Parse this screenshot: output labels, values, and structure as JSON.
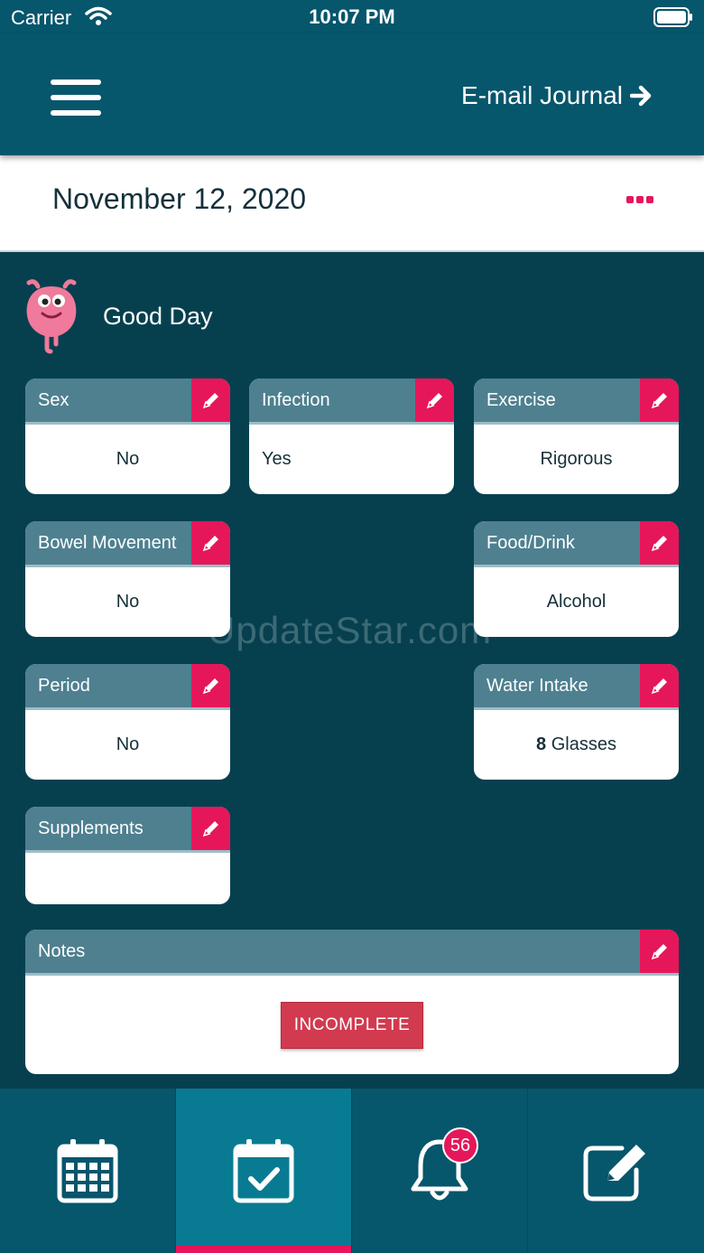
{
  "status_bar": {
    "carrier": "Carrier",
    "time": "10:07 PM"
  },
  "header": {
    "email_label": "E-mail Journal"
  },
  "date_bar": {
    "date": "November 12, 2020"
  },
  "mood": {
    "label": "Good Day"
  },
  "cards": {
    "sex": {
      "title": "Sex",
      "value": "No"
    },
    "infection": {
      "title": "Infection",
      "value": "Yes"
    },
    "exercise": {
      "title": "Exercise",
      "value": "Rigorous"
    },
    "bowel": {
      "title": "Bowel Movement",
      "value": "No"
    },
    "food": {
      "title": "Food/Drink",
      "value": "Alcohol"
    },
    "period": {
      "title": "Period",
      "value": "No"
    },
    "water": {
      "title": "Water Intake",
      "value_number": "8",
      "value_unit": " Glasses"
    },
    "supplements": {
      "title": "Supplements",
      "value": ""
    }
  },
  "notes": {
    "title": "Notes",
    "status_button": "INCOMPLETE"
  },
  "watermark": "UpdateStar.com",
  "tabs": {
    "active_index": 1,
    "notification_count": "56",
    "icons": [
      "calendar-icon",
      "calendar-check-icon",
      "bell-icon",
      "edit-note-icon"
    ]
  },
  "colors": {
    "primary": "#06566c",
    "background": "#06404f",
    "accent": "#e5175a",
    "card_header": "#4e8090",
    "active_tab": "#087b92",
    "incomplete": "#d23a4f"
  }
}
